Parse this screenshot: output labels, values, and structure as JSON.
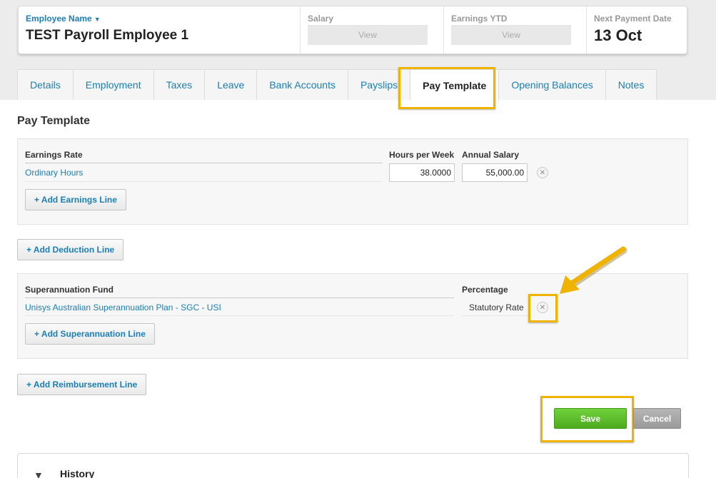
{
  "header": {
    "employee_name_label": "Employee Name",
    "employee_name": "TEST Payroll Employee 1",
    "salary_label": "Salary",
    "salary_view": "View",
    "earnings_ytd_label": "Earnings YTD",
    "earnings_ytd_view": "View",
    "next_payment_label": "Next Payment Date",
    "next_payment_date": "13 Oct"
  },
  "tabs": [
    {
      "label": "Details"
    },
    {
      "label": "Employment"
    },
    {
      "label": "Taxes"
    },
    {
      "label": "Leave"
    },
    {
      "label": "Bank Accounts"
    },
    {
      "label": "Payslips"
    },
    {
      "label": "Pay Template",
      "active": true
    },
    {
      "label": "Opening Balances"
    },
    {
      "label": "Notes"
    }
  ],
  "pay_template": {
    "title": "Pay Template",
    "earnings": {
      "col_rate": "Earnings Rate",
      "col_hours": "Hours per Week",
      "col_salary": "Annual Salary",
      "rows": [
        {
          "rate": "Ordinary Hours",
          "hours": "38.0000",
          "salary": "55,000.00"
        }
      ],
      "add_label": "+ Add Earnings Line"
    },
    "add_deduction_label": "+ Add Deduction Line",
    "super": {
      "col_fund": "Superannuation Fund",
      "col_percentage": "Percentage",
      "rows": [
        {
          "fund": "Unisys Australian Superannuation Plan - SGC - USI",
          "percentage": "Statutory Rate"
        }
      ],
      "add_label": "+ Add Superannuation Line"
    },
    "add_reimbursement_label": "+ Add Reimbursement Line"
  },
  "actions": {
    "save_label": "Save",
    "cancel_label": "Cancel"
  },
  "history": {
    "title": "History"
  },
  "colors": {
    "link": "#1a7fb8",
    "highlight": "#f0b400",
    "save_green": "#5cbf2a",
    "cancel_grey": "#a6a6a6"
  }
}
